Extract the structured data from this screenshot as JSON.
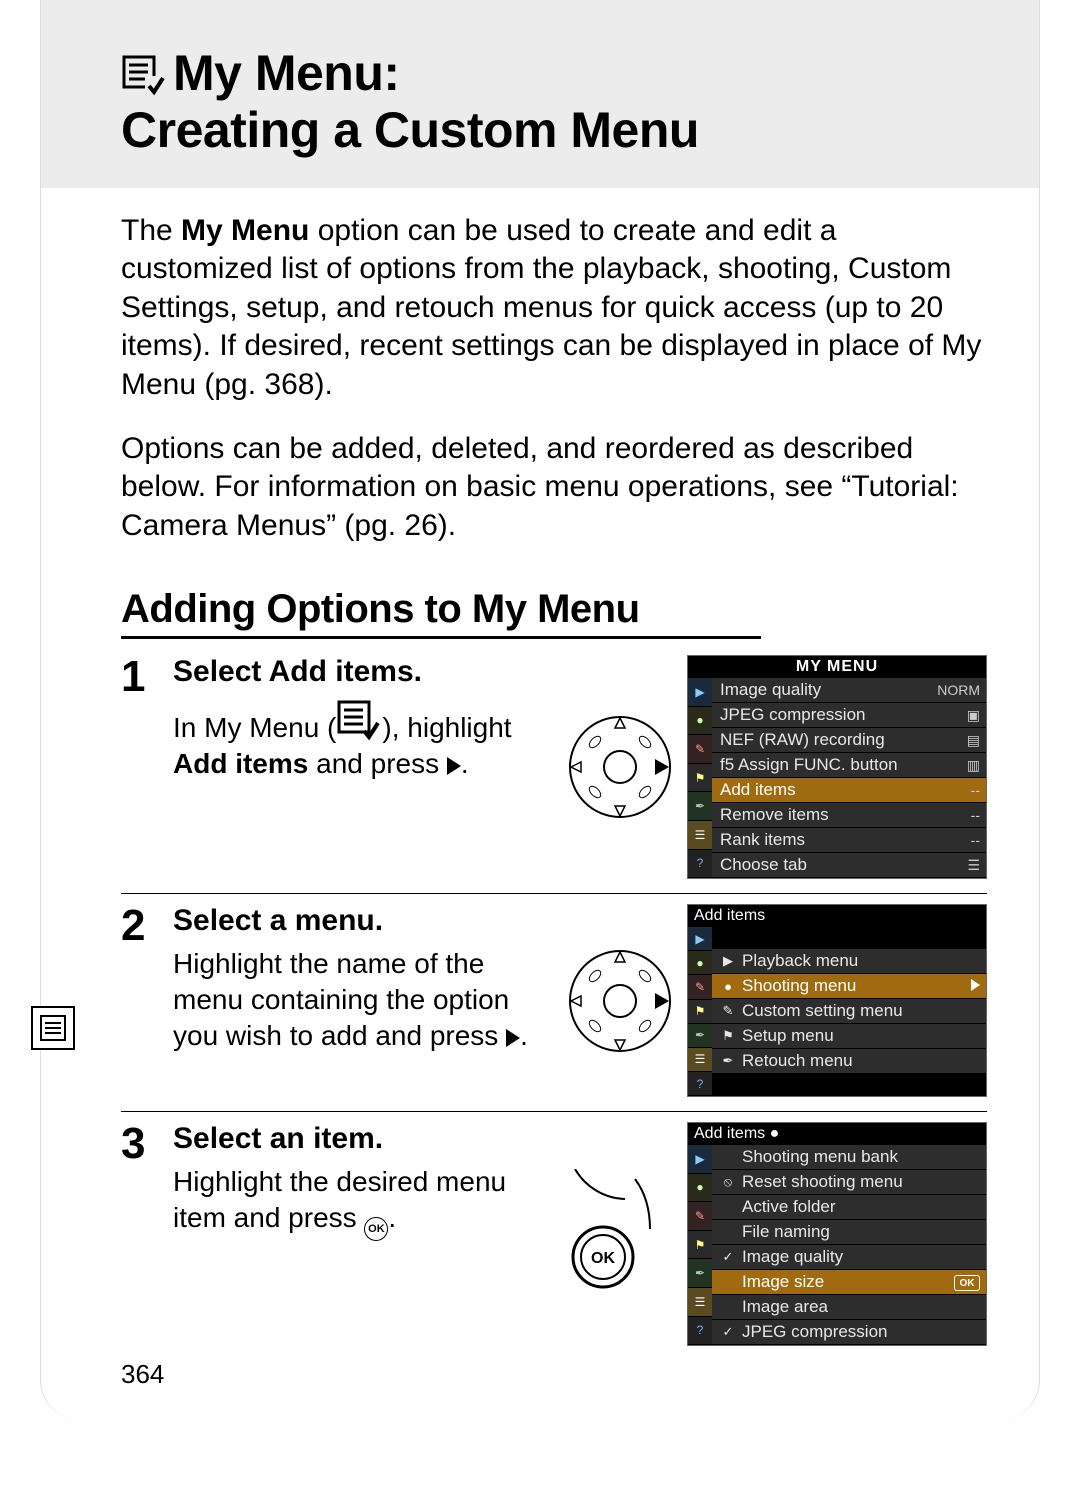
{
  "title_line1": "My Menu:",
  "title_line2": "Creating a Custom Menu",
  "intro_html_1a": "The ",
  "intro_bold_1": "My Menu",
  "intro_html_1b": " option can be used to create and edit a customized list of options from the playback, shooting, Custom Settings, setup, and retouch menus for quick access (up to 20 items).  If desired, recent settings can be displayed in place of My Menu (pg. 368).",
  "intro_2": "Options can be added, deleted, and reordered as described below. For information on basic menu operations, see “Tutorial: Camera Menus” (pg. 26).",
  "section_heading": "Adding Options to My Menu",
  "steps": [
    {
      "num": "1",
      "title_a": "Select ",
      "title_b_bold": "Add items",
      "title_c": ".",
      "desc_a": "In My Menu (",
      "desc_b": "), highlight ",
      "desc_c_bold": "Add items",
      "desc_d": " and press ",
      "desc_e": "."
    },
    {
      "num": "2",
      "title": "Select a menu.",
      "desc_a": "Highlight the name of the menu containing the option you wish to add and press ",
      "desc_b": "."
    },
    {
      "num": "3",
      "title": "Select an item.",
      "desc_a": "Highlight the desired menu item and press ",
      "desc_b": "."
    }
  ],
  "lcd1": {
    "title": "MY MENU",
    "rows": [
      {
        "l": "Image quality",
        "r": "NORM"
      },
      {
        "l": "JPEG compression",
        "r": "▣"
      },
      {
        "l": "NEF (RAW) recording",
        "r": "▤"
      },
      {
        "l": "f5 Assign FUNC. button",
        "r": "▥"
      },
      {
        "l": "Add items",
        "r": "--",
        "hl": true
      },
      {
        "l": "Remove items",
        "r": "--"
      },
      {
        "l": "Rank items",
        "r": "--"
      },
      {
        "l": "Choose tab",
        "r": "☰"
      }
    ]
  },
  "lcd2": {
    "title": "Add items",
    "rows": [
      {
        "ic": "▶",
        "l": "Playback menu"
      },
      {
        "ic": "●",
        "l": "Shooting menu",
        "hl": true,
        "arrow": true
      },
      {
        "ic": "✎",
        "l": "Custom setting menu"
      },
      {
        "ic": "⚑",
        "l": "Setup menu"
      },
      {
        "ic": "✒",
        "l": "Retouch menu"
      }
    ]
  },
  "lcd3": {
    "title": "Add items ●",
    "rows": [
      {
        "l": "Shooting menu bank"
      },
      {
        "ic": "⦸",
        "l": "Reset shooting menu"
      },
      {
        "l": "Active folder"
      },
      {
        "l": "File naming"
      },
      {
        "ic": "✓",
        "l": "Image quality"
      },
      {
        "l": "Image size",
        "hl": true,
        "ok": true
      },
      {
        "l": "Image area"
      },
      {
        "ic": "✓",
        "l": "JPEG compression"
      }
    ]
  },
  "page_number": "364",
  "ok_label": "OK"
}
